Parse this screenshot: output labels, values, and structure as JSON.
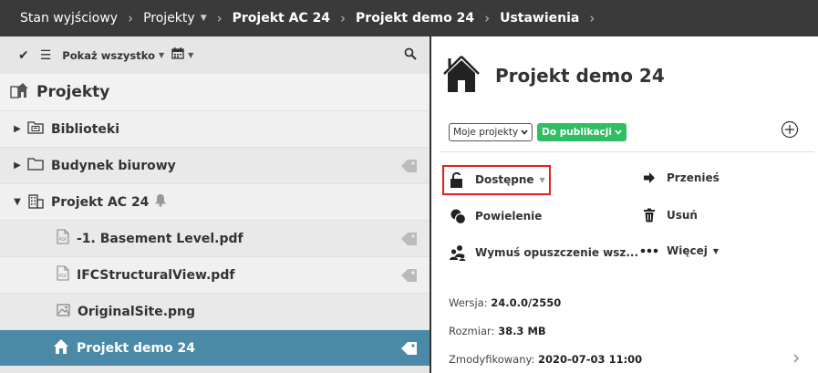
{
  "breadcrumb": {
    "items": [
      "Stan wyjściowy",
      "Projekty",
      "Projekt AC 24",
      "Projekt demo 24",
      "Ustawienia"
    ]
  },
  "toolbar": {
    "filter_label": "Pokaż wszystko"
  },
  "tree": {
    "header": "Projekty",
    "items": [
      {
        "label": "Biblioteki"
      },
      {
        "label": "Budynek biurowy"
      },
      {
        "label": "Projekt AC 24"
      },
      {
        "label": "-1. Basement Level.pdf"
      },
      {
        "label": "IFCStructuralView.pdf"
      },
      {
        "label": "OriginalSite.png"
      },
      {
        "label": "Projekt demo 24"
      }
    ]
  },
  "detail": {
    "title": "Projekt demo 24",
    "filter_select": "Moje projekty",
    "status_pill": "Do publikacji",
    "actions": {
      "available": "Dostępne",
      "move": "Przenieś",
      "duplicate": "Powielenie",
      "delete": "Usuń",
      "force_leave": "Wymuś opuszczenie wsz...",
      "more": "Więcej"
    },
    "info": {
      "version_label": "Wersja:",
      "version_value": "24.0.0/2550",
      "size_label": "Rozmiar:",
      "size_value": "38.3 MB",
      "modified_label": "Zmodyfikowany:",
      "modified_value": "2020-07-03 11:00"
    }
  },
  "colors": {
    "topbar": "#3a3a3a",
    "selected_row": "#4a8aa6",
    "status_pill": "#2fbf62",
    "highlight": "#e02020"
  }
}
